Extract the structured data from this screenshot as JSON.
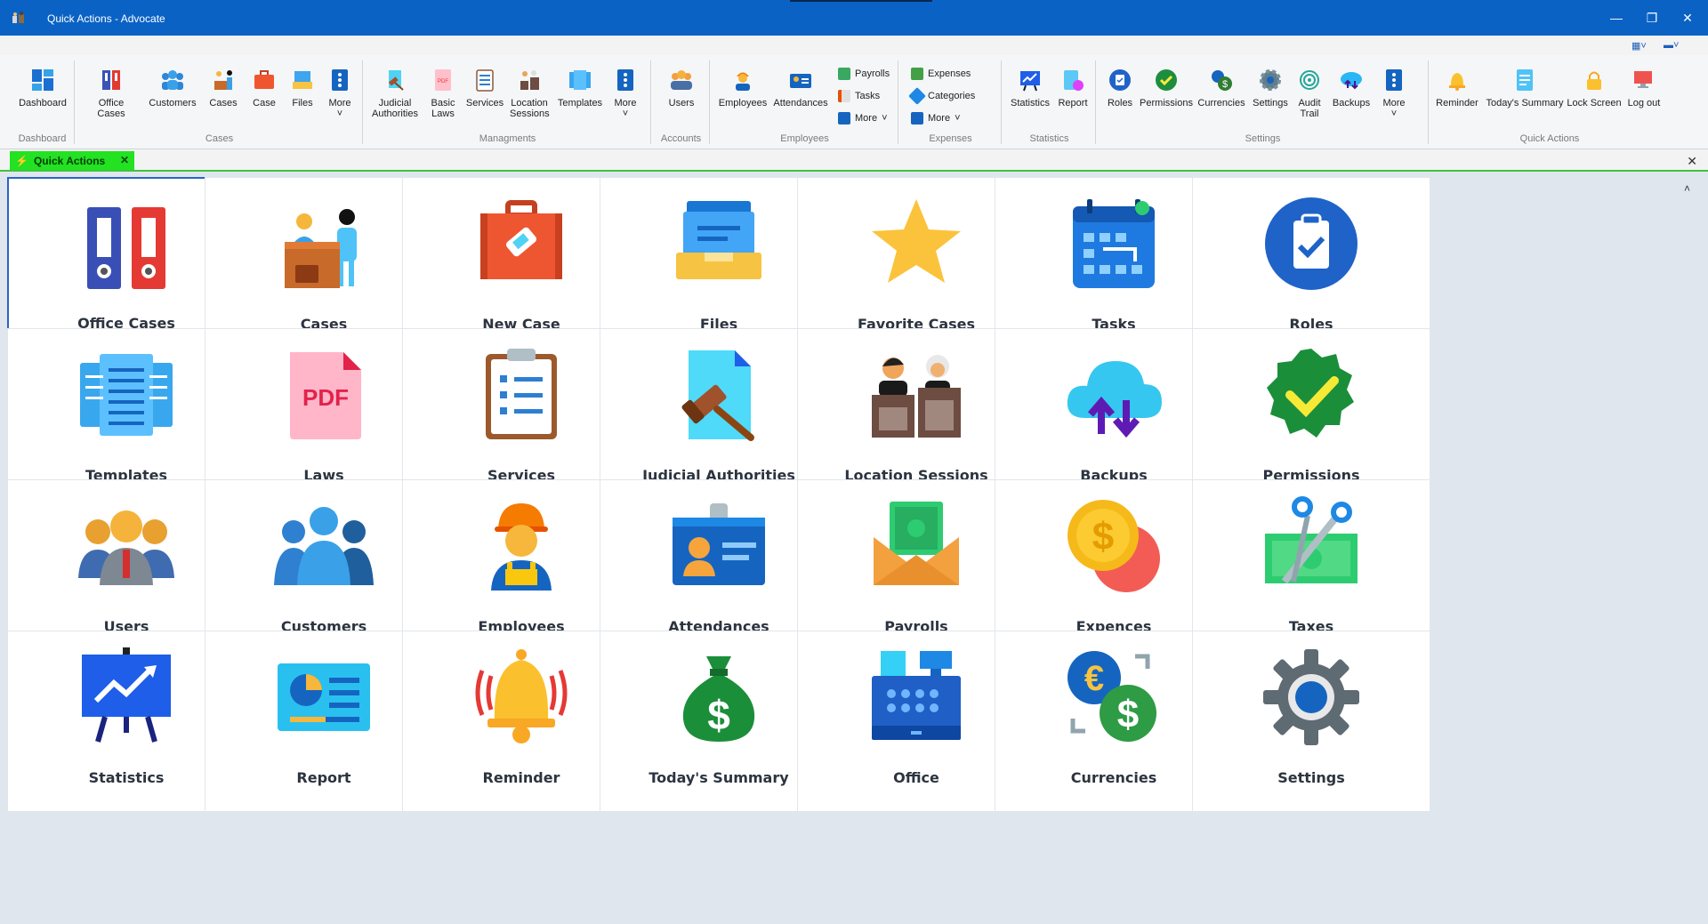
{
  "window": {
    "title": "Quick Actions - Advocate"
  },
  "ribbon": {
    "groups": [
      {
        "label": "Dashboard",
        "buttons": [
          "Dashboard"
        ]
      },
      {
        "label": "Cases",
        "buttons": [
          "Office Cases",
          "Customers",
          "Cases",
          "Case",
          "Files",
          "More"
        ]
      },
      {
        "label": "Managments",
        "buttons": [
          "Judicial Authorities",
          "Basic Laws",
          "Services",
          "Location Sessions",
          "Templates",
          "More"
        ]
      },
      {
        "label": "Accounts",
        "buttons": [
          "Users"
        ]
      },
      {
        "label": "Employees",
        "buttons": [
          "Employees",
          "Attendances"
        ],
        "small": [
          "Payrolls",
          "Tasks",
          "More"
        ]
      },
      {
        "label": "Expenses",
        "small": [
          "Expenses",
          "Categories",
          "More"
        ]
      },
      {
        "label": "Statistics",
        "buttons": [
          "Statistics",
          "Report"
        ]
      },
      {
        "label": "Settings",
        "buttons": [
          "Roles",
          "Permissions",
          "Currencies",
          "Settings",
          "Audit Trail",
          "Backups",
          "More"
        ]
      },
      {
        "label": "Quick Actions",
        "buttons": [
          "Reminder",
          "Today's Summary",
          "Lock Screen",
          "Log out"
        ]
      }
    ]
  },
  "tab": {
    "label": "Quick Actions"
  },
  "tiles": [
    {
      "label": "Office Cases",
      "icon": "binders-icon"
    },
    {
      "label": "Cases",
      "icon": "reception-desk-icon"
    },
    {
      "label": "New Case",
      "icon": "briefcase-icon"
    },
    {
      "label": "Files",
      "icon": "file-tray-icon"
    },
    {
      "label": "Favorite Cases",
      "icon": "star-icon"
    },
    {
      "label": "Tasks",
      "icon": "calendar-icon"
    },
    {
      "label": "Roles",
      "icon": "clipboard-check-icon"
    },
    {
      "label": "Templates",
      "icon": "templates-icon"
    },
    {
      "label": "Laws",
      "icon": "pdf-icon"
    },
    {
      "label": "Services",
      "icon": "checklist-icon"
    },
    {
      "label": "Judicial Authorities",
      "icon": "gavel-document-icon"
    },
    {
      "label": "Location Sessions",
      "icon": "courtroom-icon"
    },
    {
      "label": "Backups",
      "icon": "cloud-sync-icon"
    },
    {
      "label": "Permissions",
      "icon": "verified-badge-icon"
    },
    {
      "label": "Users",
      "icon": "users-group-icon"
    },
    {
      "label": "Customers",
      "icon": "customers-icon"
    },
    {
      "label": "Employees",
      "icon": "worker-icon"
    },
    {
      "label": "Attendances",
      "icon": "id-card-icon"
    },
    {
      "label": "Payrolls",
      "icon": "money-envelope-icon"
    },
    {
      "label": "Expences",
      "icon": "coins-icon"
    },
    {
      "label": "Taxes",
      "icon": "scissors-bill-icon"
    },
    {
      "label": "Statistics",
      "icon": "presentation-chart-icon"
    },
    {
      "label": "Report",
      "icon": "report-icon"
    },
    {
      "label": "Reminder",
      "icon": "bell-icon"
    },
    {
      "label": "Today's Summary",
      "icon": "money-bag-icon"
    },
    {
      "label": "Office",
      "icon": "cash-register-icon"
    },
    {
      "label": "Currencies",
      "icon": "currency-exchange-icon"
    },
    {
      "label": "Settings",
      "icon": "gear-icon"
    }
  ]
}
